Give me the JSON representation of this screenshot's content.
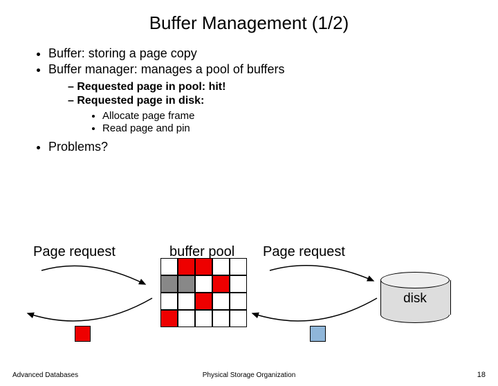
{
  "title": "Buffer Management (1/2)",
  "bullets": {
    "b1": "Buffer: storing a page copy",
    "b2": "Buffer manager: manages a pool of buffers",
    "s1": "Requested page in pool: hit!",
    "s2": "Requested page in disk:",
    "t1": "Allocate page frame",
    "t2": "Read page and pin",
    "b3": "Problems?"
  },
  "labels": {
    "page_request_left": "Page request",
    "page_request_right": "Page request",
    "buffer_pool": "buffer pool",
    "disk": "disk"
  },
  "grid": {
    "rows": 4,
    "cols": 5,
    "red_cells": [
      [
        0,
        1
      ],
      [
        0,
        2
      ],
      [
        1,
        3
      ],
      [
        2,
        2
      ],
      [
        3,
        0
      ]
    ],
    "grey_cells": [
      [
        1,
        0
      ],
      [
        1,
        1
      ]
    ]
  },
  "footer": {
    "left": "Advanced Databases",
    "center": "Physical Storage Organization",
    "right": "18"
  }
}
